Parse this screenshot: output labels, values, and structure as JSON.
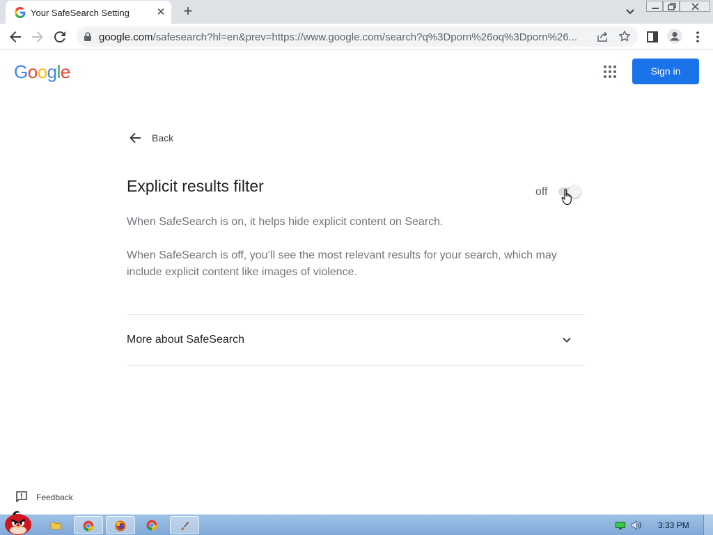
{
  "browser": {
    "tab_title": "Your SafeSearch Setting",
    "tab_close": "✕",
    "new_tab": "+",
    "url_host": "google.com",
    "url_rest": "/safesearch?hl=en&prev=https://www.google.com/search?q%3Dporn%26oq%3Dporn%26..."
  },
  "header": {
    "logo_letters": [
      "G",
      "o",
      "o",
      "g",
      "l",
      "e"
    ],
    "logo_colors": [
      "#4285f4",
      "#ea4335",
      "#fbbc05",
      "#4285f4",
      "#34a853",
      "#ea4335"
    ],
    "signin_label": "Sign in",
    "accent": "#1a73e8"
  },
  "back": {
    "label": "Back"
  },
  "filter": {
    "title": "Explicit results filter",
    "state_label": "off",
    "enabled": false
  },
  "descriptions": {
    "on": "When SafeSearch is on, it helps hide explicit content on Search.",
    "off": "When SafeSearch is off, you’ll see the most relevant results for your search, which may include explicit content like images of violence."
  },
  "more": {
    "label": "More about SafeSearch"
  },
  "feedback": {
    "label": "Feedback"
  },
  "taskbar": {
    "clock": "3:33 PM",
    "apps": [
      "file-explorer-icon",
      "chrome-icon",
      "firefox-icon",
      "chrome-icon",
      "paint-icon"
    ]
  }
}
